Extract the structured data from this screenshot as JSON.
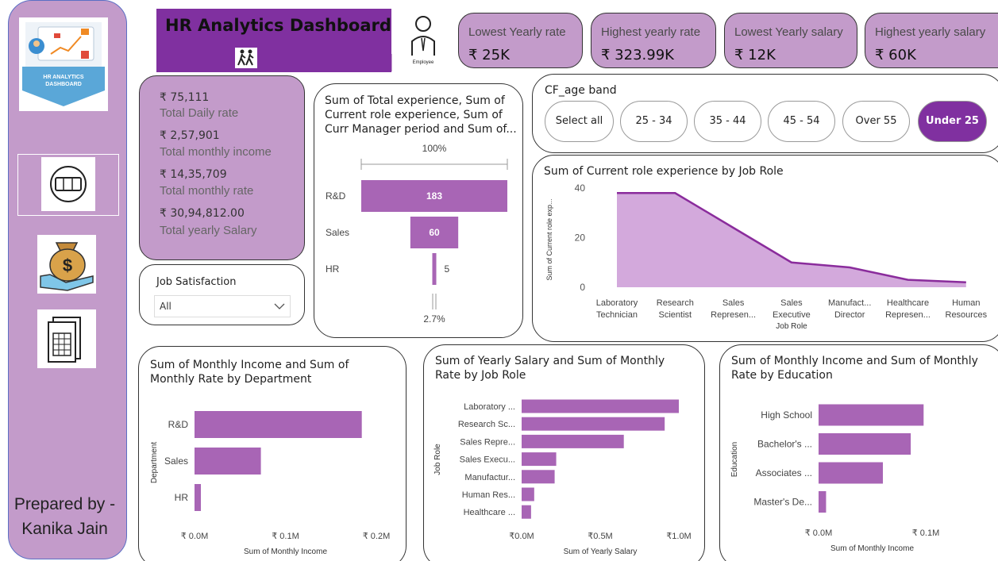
{
  "sidebar": {
    "logo_line1": "HR ANALYTICS",
    "logo_line2": "DASHBOARD",
    "prepared_line1": "Prepared by -",
    "prepared_line2": "Kanika Jain"
  },
  "title": "HR  Analytics Dashboard",
  "employee_icon_label": "Employee",
  "kpis": [
    {
      "label": "Lowest Yearly rate",
      "value": "₹ 25K"
    },
    {
      "label": "Highest yearly rate",
      "value": "₹ 323.99K"
    },
    {
      "label": "Lowest Yearly salary",
      "value": "₹ 12K"
    },
    {
      "label": "Highest yearly salary",
      "value": "₹ 60K"
    }
  ],
  "totals": [
    {
      "value": "₹ 75,111",
      "label": "Total Daily rate"
    },
    {
      "value": "₹ 2,57,901",
      "label": "Total monthly income"
    },
    {
      "value": "₹ 14,35,709",
      "label": "Total monthly rate"
    },
    {
      "value": "₹ 30,94,812.00",
      "label": "Total yearly Salary"
    }
  ],
  "job_satisfaction": {
    "title": "Job Satisfaction",
    "selected": "All"
  },
  "age_band": {
    "title": "CF_age band",
    "options": [
      "Select all",
      "25 - 34",
      "35 - 44",
      "45 - 54",
      "Over 55",
      "Under 25"
    ],
    "selected": "Under 25"
  },
  "colors": {
    "accent": "#8030a0",
    "bar": "#a865b5",
    "area": "#d3a9dc",
    "panel": "#c39bca"
  },
  "chart_data": [
    {
      "type": "bar",
      "subtype": "funnel",
      "title": "Sum of Total experience, Sum of Current role experience, Sum of Curr Manager period and Sum of...",
      "title_lines": [
        "Sum of Total experience, Sum of",
        "Current role experience, Sum of",
        "Curr Manager period and Sum of..."
      ],
      "categories": [
        "R&D",
        "Sales",
        "HR"
      ],
      "values": [
        183,
        60,
        5
      ],
      "top_label": "100%",
      "bottom_label": "2.7%"
    },
    {
      "type": "area",
      "title": "Sum of Current role experience by Job Role",
      "xlabel": "Job Role",
      "ylabel": "Sum of Current role exp...",
      "categories": [
        [
          "Laboratory",
          "Technician"
        ],
        [
          "Research",
          "Scientist"
        ],
        [
          "Sales",
          "Represen..."
        ],
        [
          "Sales",
          "Executive"
        ],
        [
          "Manufact...",
          "Director"
        ],
        [
          "Healthcare",
          "Represen..."
        ],
        [
          "Human",
          "Resources"
        ]
      ],
      "values": [
        38,
        38,
        24,
        10,
        8,
        3,
        2
      ],
      "yticks": [
        "0",
        "20",
        "40"
      ],
      "ylim": [
        0,
        40
      ]
    },
    {
      "type": "bar",
      "orientation": "horizontal",
      "title": "Sum of Monthly Income and Sum of Monthly Rate by Department",
      "title_lines": [
        "Sum of Monthly Income and Sum of",
        "Monthly Rate by Department"
      ],
      "xlabel": "Sum of Monthly Income",
      "ylabel": "Department",
      "categories": [
        "R&D",
        "Sales",
        "HR"
      ],
      "values": [
        0.184,
        0.073,
        0.007
      ],
      "xticks": [
        "₹ 0.0M",
        "₹ 0.1M",
        "₹ 0.2M"
      ],
      "xlim": [
        0,
        0.2
      ]
    },
    {
      "type": "bar",
      "orientation": "horizontal",
      "title": "Sum of Yearly Salary and Sum of Monthly Rate by Job Role",
      "title_lines": [
        "Sum of Yearly Salary and Sum of Monthly",
        "Rate by Job Role"
      ],
      "xlabel": "Sum of Yearly Salary",
      "ylabel": "Job Role",
      "categories": [
        "Laboratory ...",
        "Research Sc...",
        "Sales Repre...",
        "Sales Execu...",
        "Manufactur...",
        "Human Res...",
        "Healthcare ..."
      ],
      "values": [
        1.0,
        0.91,
        0.65,
        0.22,
        0.21,
        0.08,
        0.06
      ],
      "xticks": [
        "₹0.0M",
        "₹0.5M",
        "₹1.0M"
      ],
      "xlim": [
        0,
        1.0
      ]
    },
    {
      "type": "bar",
      "orientation": "horizontal",
      "title": "Sum of Monthly Income and Sum of Monthly Rate by Education",
      "title_lines": [
        "Sum of Monthly Income and Sum of Monthly",
        "Rate by Education"
      ],
      "xlabel": "Sum of Monthly Income",
      "ylabel": "Education",
      "categories": [
        "High School",
        "Bachelor's ...",
        "Associates ...",
        "Master's De..."
      ],
      "values": [
        0.098,
        0.086,
        0.06,
        0.007
      ],
      "xticks": [
        "₹ 0.0M",
        "₹ 0.1M"
      ],
      "xlim": [
        0,
        0.1
      ]
    }
  ]
}
